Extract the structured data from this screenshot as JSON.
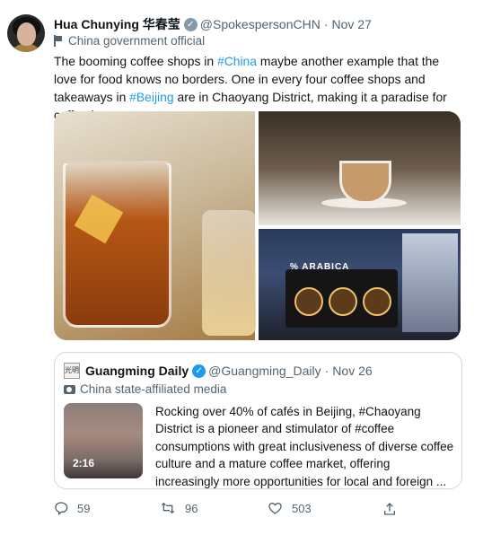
{
  "tweet": {
    "author_name": "Hua Chunying 华春莹",
    "handle": "@SpokespersonCHN",
    "separator": "·",
    "date": "Nov 27",
    "label": "China government official",
    "text_parts": [
      "The booming coffee shops in ",
      "#China",
      " maybe another example that the love for food knows no borders. One in every four coffee shops and takeaways in ",
      "#Beijing",
      " are in Chaoyang District, making it a paradise for coffee lovers."
    ],
    "image3_sign": "% ARABICA"
  },
  "quoted": {
    "avatar_text": "光明",
    "author_name": "Guangming Daily",
    "handle": "@Guangming_Daily",
    "separator": "·",
    "date": "Nov 26",
    "label": "China state-affiliated media",
    "video_duration": "2:16",
    "text": "Rocking over 40% of cafés in Beijing, #Chaoyang District is a pioneer and stimulator of #coffee consumptions with great inclusiveness of diverse coffee culture and a mature coffee market, offering increasingly more opportunities for local and foreign ..."
  },
  "actions": {
    "reply_count": "59",
    "retweet_count": "96",
    "like_count": "503"
  },
  "colors": {
    "link": "#1d9bf0",
    "muted": "#536471",
    "verified_gray": "#829aab",
    "verified_blue": "#1d9bf0"
  }
}
